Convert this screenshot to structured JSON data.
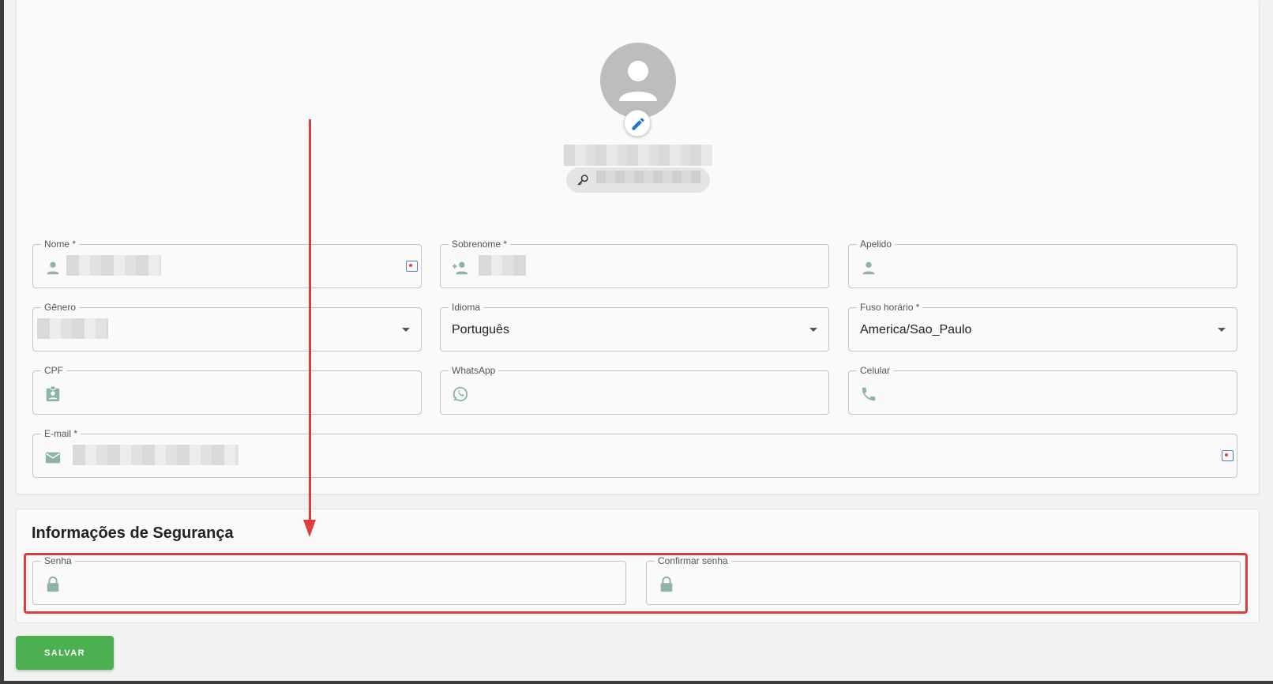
{
  "profile": {
    "avatar_icon": "person-icon",
    "edit_icon": "pencil-icon",
    "chip_icon": "key-icon"
  },
  "fields": {
    "nome": {
      "label": "Nome *",
      "icon": "person-icon"
    },
    "sobrenome": {
      "label": "Sobrenome *",
      "icon": "person-add-icon"
    },
    "apelido": {
      "label": "Apelido",
      "icon": "person-icon"
    },
    "genero": {
      "label": "Gênero"
    },
    "idioma": {
      "label": "Idioma",
      "value": "Português"
    },
    "fuso": {
      "label": "Fuso horário *",
      "value": "America/Sao_Paulo"
    },
    "cpf": {
      "label": "CPF",
      "icon": "id-badge-icon"
    },
    "whatsapp": {
      "label": "WhatsApp",
      "icon": "whatsapp-icon"
    },
    "celular": {
      "label": "Celular",
      "icon": "phone-icon"
    },
    "email": {
      "label": "E-mail *",
      "icon": "mail-icon"
    }
  },
  "security": {
    "title": "Informações de Segurança",
    "senha": {
      "label": "Senha",
      "icon": "lock-icon"
    },
    "confirmar": {
      "label": "Confirmar senha",
      "icon": "lock-icon"
    }
  },
  "actions": {
    "save_label": "SALVAR"
  },
  "colors": {
    "accent_green": "#4caf50",
    "annotation_red": "#e03c3c",
    "icon_teal": "#8fb3a8",
    "edit_blue": "#1976d2"
  }
}
